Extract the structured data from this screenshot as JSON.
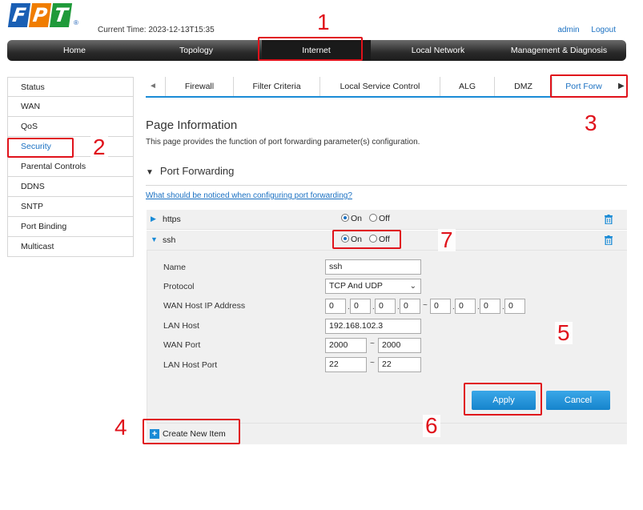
{
  "brand": {
    "letters": [
      "F",
      "P",
      "T"
    ],
    "colors": [
      "#1a5fb4",
      "#f07d00",
      "#1f9a3a"
    ],
    "registered": "®"
  },
  "header": {
    "current_time": "Current Time: 2023-12-13T15:35",
    "admin": "admin",
    "logout": "Logout"
  },
  "mainnav": [
    "Home",
    "Topology",
    "Internet",
    "Local Network",
    "Management & Diagnosis"
  ],
  "mainnav_active": "Internet",
  "sidebar": [
    "Status",
    "WAN",
    "QoS",
    "Security",
    "Parental Controls",
    "DDNS",
    "SNTP",
    "Port Binding",
    "Multicast"
  ],
  "sidebar_active": "Security",
  "tabs": {
    "prev_arrow": "◄",
    "next_arrow": "▶",
    "items": [
      "Firewall",
      "Filter Criteria",
      "Local Service Control",
      "ALG",
      "DMZ",
      "Port Forw"
    ],
    "active": "Port Forw"
  },
  "page": {
    "title": "Page Information",
    "description": "This page provides the function of port forwarding parameter(s) configuration.",
    "section_title": "Port Forwarding",
    "section_arrow": "▼",
    "help_link": "What should be noticed when configuring port forwarding?"
  },
  "entries": [
    {
      "name": "https",
      "expand_icon": "▶",
      "state": "On"
    },
    {
      "name": "ssh",
      "expand_icon": "▼",
      "state": "On"
    }
  ],
  "radio_labels": {
    "on": "On",
    "off": "Off"
  },
  "form": {
    "labels": {
      "name": "Name",
      "protocol": "Protocol",
      "wan_host_ip": "WAN Host IP Address",
      "lan_host": "LAN Host",
      "wan_port": "WAN Port",
      "lan_host_port": "LAN Host Port"
    },
    "name": "ssh",
    "protocol": "TCP And UDP",
    "wan_ip_start": [
      "0",
      "0",
      "0",
      "0"
    ],
    "wan_ip_end": [
      "0",
      "0",
      "0",
      "0"
    ],
    "lan_host": "192.168.102.3",
    "wan_port_start": "2000",
    "wan_port_end": "2000",
    "lan_port_start": "22",
    "lan_port_end": "22",
    "dot": ".",
    "tilde": "~"
  },
  "buttons": {
    "apply": "Apply",
    "cancel": "Cancel",
    "create_new": "Create New Item"
  },
  "annotations": [
    "1",
    "2",
    "3",
    "4",
    "5",
    "6",
    "7"
  ],
  "colors": {
    "accent": "#1a8bd6",
    "highlight": "#e0121b",
    "link": "#1a70c2"
  }
}
